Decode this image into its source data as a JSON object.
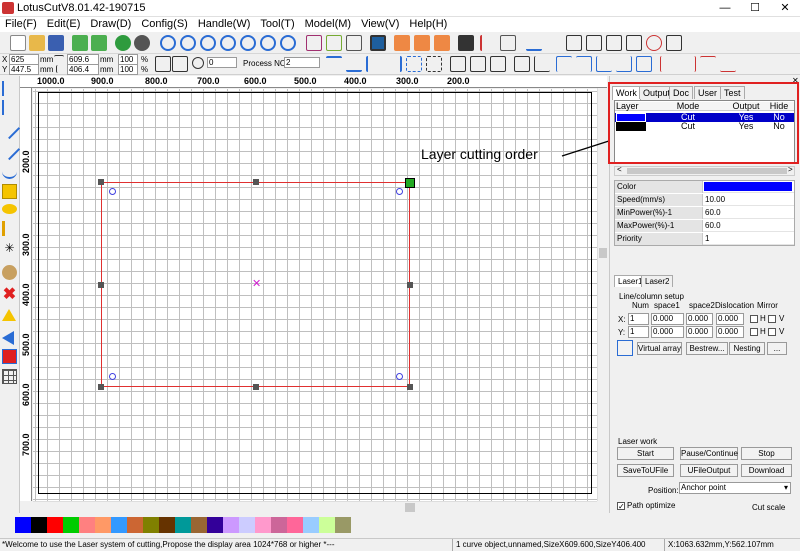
{
  "window": {
    "title": "LotusCutV8.01.42-190715",
    "minimize": "—",
    "maximize": "☐",
    "close": "✕"
  },
  "menu": [
    "File(F)",
    "Edit(E)",
    "Draw(D)",
    "Config(S)",
    "Handle(W)",
    "Tool(T)",
    "Model(M)",
    "View(V)",
    "Help(H)"
  ],
  "toolbar2": {
    "x_label": "X",
    "y_label": "Y",
    "x_value": "625",
    "y_value": "447.5",
    "unit_mm": "mm",
    "width_value": "609.6",
    "height_value": "406.4",
    "scale_w": "100",
    "scale_h": "100",
    "percent": "%",
    "rotation": "0",
    "process_label": "Process NO:",
    "process_value": "2"
  },
  "ruler": {
    "h_labels": [
      "1000.0",
      "900.0",
      "800.0",
      "700.0",
      "600.0",
      "500.0",
      "400.0",
      "300.0",
      "200.0"
    ],
    "v_labels": [
      "200.0",
      "300.0",
      "400.0",
      "500.0",
      "600.0",
      "700.0"
    ]
  },
  "annotation": "Layer cutting order",
  "panel": {
    "tabs": [
      "Work",
      "Output",
      "Doc",
      "User",
      "Test"
    ],
    "layer_headers": [
      "Layer",
      "Mode",
      "Output",
      "Hide"
    ],
    "layers": [
      {
        "color": "#0000ff",
        "mode": "Cut",
        "output": "Yes",
        "hide": "No"
      },
      {
        "color": "#000000",
        "mode": "Cut",
        "output": "Yes",
        "hide": "No"
      }
    ],
    "props": [
      {
        "key": "Color",
        "value": ""
      },
      {
        "key": "Speed(mm/s)",
        "value": "10.00"
      },
      {
        "key": "MinPower(%)-1",
        "value": "60.0"
      },
      {
        "key": "MaxPower(%)-1",
        "value": "60.0"
      },
      {
        "key": "Priority",
        "value": "1"
      }
    ],
    "laser_tabs": [
      "Laser1",
      "Laser2"
    ],
    "array": {
      "title": "Line/column setup",
      "headers": [
        "Num",
        "space1",
        "space2",
        "Dislocation",
        "Mirror"
      ],
      "x_label": "X:",
      "y_label": "Y:",
      "num": "1",
      "space": "0.000",
      "mirror_h": "H",
      "mirror_v": "V",
      "buttons": [
        "Virtual array",
        "Bestrew...",
        "Nesting",
        "..."
      ]
    },
    "laser_work": {
      "title": "Laser work",
      "buttons": [
        "Start",
        "Pause/Continue",
        "Stop",
        "SaveToUFile",
        "UFileOutput",
        "Download"
      ],
      "position_label": "Position:",
      "position_value": "Anchor point",
      "path_optimize": "Path optimize",
      "cut_scale": "Cut scale"
    }
  },
  "palette": [
    "#0000ff",
    "#000000",
    "#ff0000",
    "#00cc00",
    "#ff8080",
    "#ff9966",
    "#3399ff",
    "#cc6633",
    "#808000",
    "#663300",
    "#009999",
    "#996633",
    "#330099",
    "#cc99ff",
    "#ccccff",
    "#ff99cc",
    "#cc6699",
    "#ff6699",
    "#99ccff",
    "#ccff99",
    "#999966"
  ],
  "status": {
    "left": "*Welcome to use the Laser system of cutting,Propose the display area 1024*768 or higher *---",
    "middle": "1 curve object,unnamed,SizeX609.600,SizeY406.400",
    "right": "X:1063.632mm,Y:562.107mm"
  },
  "colors": {
    "accent_red": "#e02020",
    "selection_blue": "#0000ff"
  }
}
